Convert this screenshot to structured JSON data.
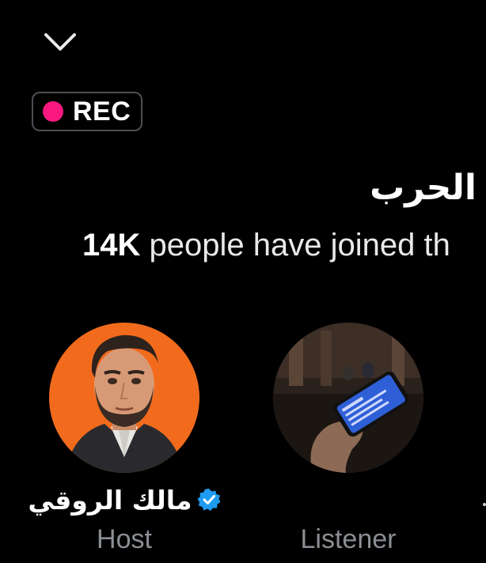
{
  "header": {
    "collapse_icon": "chevron-down-icon",
    "recording_badge": {
      "label": "REC",
      "dot_color": "#f91880"
    }
  },
  "space": {
    "title": "الحرب",
    "joined_count": "14K",
    "joined_text": "people have joined th"
  },
  "participants": [
    {
      "name": "مالك الروقي",
      "role": "Host",
      "verified": true,
      "verified_color": "#1d9bf0",
      "avatar_bg": "#f26b1d"
    },
    {
      "name": "",
      "role": "Listener",
      "verified": false
    }
  ],
  "colors": {
    "background": "#000000",
    "accent_pink": "#f91880",
    "verified_blue": "#1d9bf0",
    "muted_text": "#8b8f94"
  }
}
